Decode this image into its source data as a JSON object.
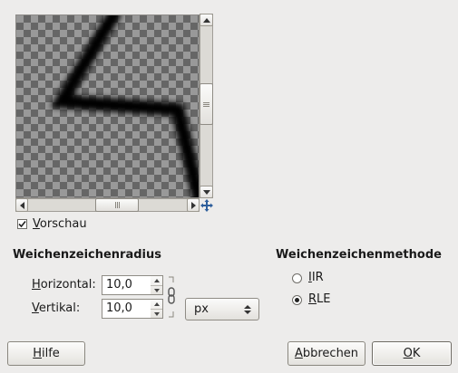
{
  "preview": {
    "checkbox_label": "Vorschau",
    "checked": true
  },
  "radius": {
    "heading": "Weichenzeichenradius",
    "horizontal_label": "Horizontal:",
    "horizontal_value": "10,0",
    "vertical_label": "Vertikal:",
    "vertical_value": "10,0",
    "unit": "px"
  },
  "method": {
    "heading": "Weichenzeichenmethode",
    "options": [
      {
        "label": "IIR",
        "selected": false
      },
      {
        "label": "RLE",
        "selected": true
      }
    ]
  },
  "buttons": {
    "help": "Hilfe",
    "cancel": "Abbrechen",
    "ok": "OK"
  },
  "icons": [
    "scroll-up-icon",
    "scroll-down-icon",
    "scroll-left-icon",
    "scroll-right-icon",
    "move-navigate-icon",
    "chain-link-icon",
    "combo-arrows-icon",
    "spin-up-icon",
    "spin-down-icon"
  ]
}
